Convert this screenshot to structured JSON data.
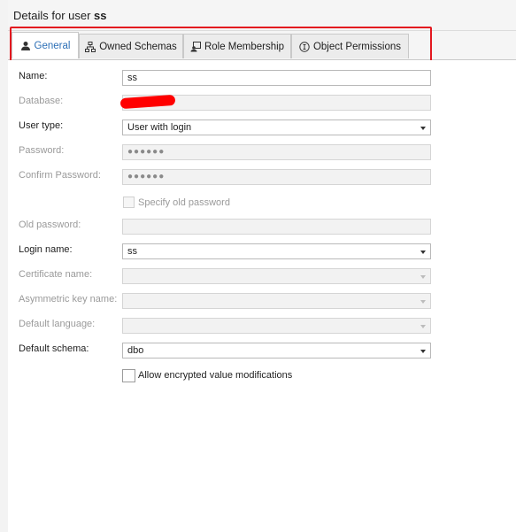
{
  "header": {
    "prefix": "Details for user ",
    "username": "ss"
  },
  "tabs": [
    {
      "label": "General",
      "icon": "user-icon",
      "active": true
    },
    {
      "label": "Owned Schemas",
      "icon": "hierarchy-icon",
      "active": false
    },
    {
      "label": "Role Membership",
      "icon": "role-icon",
      "active": false
    },
    {
      "label": "Object Permissions",
      "icon": "permission-icon",
      "active": false
    }
  ],
  "form": {
    "name": {
      "label": "Name:",
      "value": "ss"
    },
    "database": {
      "label": "Database:",
      "value": ""
    },
    "user_type": {
      "label": "User type:",
      "value": "User with login"
    },
    "password": {
      "label": "Password:",
      "value": "●●●●●●"
    },
    "confirm_password": {
      "label": "Confirm Password:",
      "value": "●●●●●●"
    },
    "specify_old_password": {
      "label": "Specify old password",
      "checked": false
    },
    "old_password": {
      "label": "Old password:",
      "value": ""
    },
    "login_name": {
      "label": "Login name:",
      "value": "ss"
    },
    "certificate_name": {
      "label": "Certificate name:",
      "value": ""
    },
    "asymmetric_key_name": {
      "label": "Asymmetric key name:",
      "value": ""
    },
    "default_language": {
      "label": "Default language:",
      "value": ""
    },
    "default_schema": {
      "label": "Default schema:",
      "value": "dbo"
    },
    "allow_encrypted": {
      "label": "Allow encrypted value modifications",
      "checked": false
    }
  },
  "colors": {
    "accent": "#2c6fb6",
    "highlight": "#e3181f",
    "redaction": "#ff0000"
  }
}
